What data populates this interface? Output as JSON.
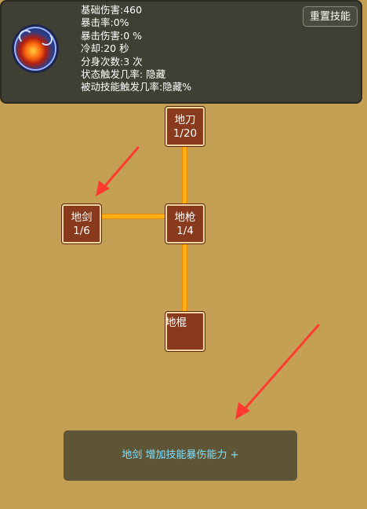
{
  "stats_panel": {
    "lines": [
      "基础伤害:460",
      "暴击率:0%",
      "暴击伤害:0 %",
      "冷却:20 秒",
      "分身次数:3 次",
      "状态触发几率: 隐藏",
      "被动技能触发几率:隐藏%"
    ],
    "reset_button_label": "重置技能",
    "skill_icon": "fire-meteor-skill-icon"
  },
  "skill_tree": {
    "nodes": [
      {
        "name": "地刀",
        "level": "1/20"
      },
      {
        "name": "地剑",
        "level": "1/6"
      },
      {
        "name": "地枪",
        "level": "1/4"
      },
      {
        "name": "地棍",
        "level": ""
      }
    ]
  },
  "description": {
    "text": "地剑  增加技能暴伤能力 +"
  },
  "colors": {
    "background": "#c4a055",
    "panel": "#3f3f34",
    "node_fill": "#8a3a1c",
    "connector": "#ffae14",
    "description_text": "#7fe0ff",
    "annotation_arrow": "#ff3b30"
  }
}
